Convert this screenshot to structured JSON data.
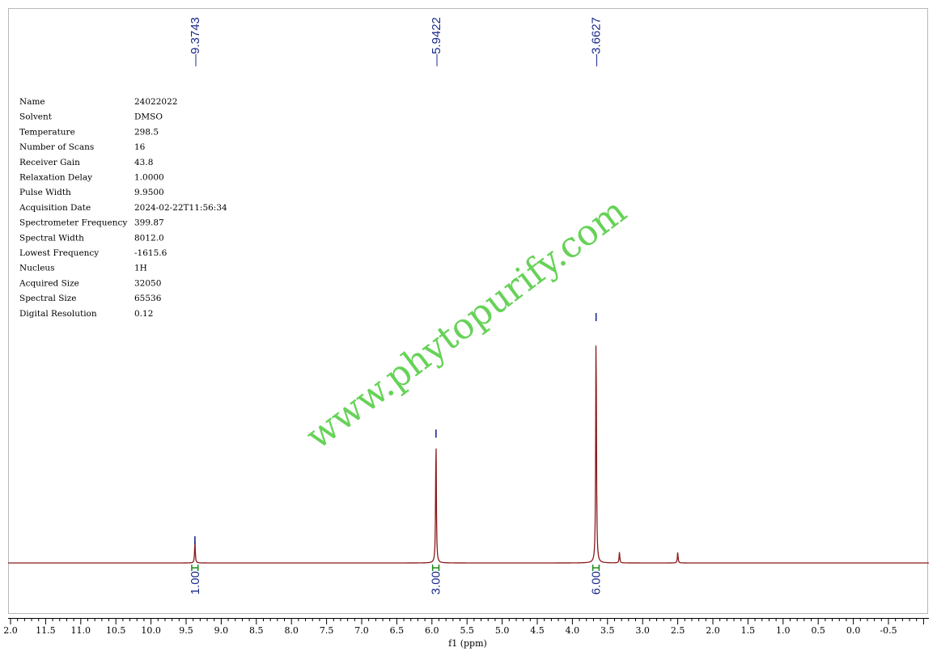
{
  "colors": {
    "spectrum": "#8b1a1a",
    "peak_marker": "#1a2a8c",
    "integration": "#1c8c1c",
    "watermark": "#5fd050",
    "frame": "#b8b8b8"
  },
  "watermark": "www.phytopurify.com",
  "parameters": [
    {
      "label": "Name",
      "value": "24022022"
    },
    {
      "label": "Solvent",
      "value": "DMSO"
    },
    {
      "label": "Temperature",
      "value": "298.5"
    },
    {
      "label": "Number of Scans",
      "value": "16"
    },
    {
      "label": "Receiver Gain",
      "value": "43.8"
    },
    {
      "label": "Relaxation Delay",
      "value": "1.0000"
    },
    {
      "label": "Pulse Width",
      "value": "9.9500"
    },
    {
      "label": "Acquisition Date",
      "value": "2024-02-22T11:56:34"
    },
    {
      "label": "Spectrometer Frequency",
      "value": "399.87"
    },
    {
      "label": "Spectral Width",
      "value": "8012.0"
    },
    {
      "label": "Lowest Frequency",
      "value": "-1615.6"
    },
    {
      "label": "Nucleus",
      "value": "1H"
    },
    {
      "label": "Acquired Size",
      "value": "32050"
    },
    {
      "label": "Spectral Size",
      "value": "65536"
    },
    {
      "label": "Digital Resolution",
      "value": "0.12"
    }
  ],
  "chart_data": {
    "type": "line",
    "xlabel": "f1 (ppm)",
    "xlim": [
      12.0,
      -1.0
    ],
    "x_reversed": true,
    "grid": false,
    "ticks": [
      {
        "value": 12.0,
        "label": "2.0"
      },
      {
        "value": 11.5,
        "label": "11.5"
      },
      {
        "value": 11.0,
        "label": "11.0"
      },
      {
        "value": 10.5,
        "label": "10.5"
      },
      {
        "value": 10.0,
        "label": "10.0"
      },
      {
        "value": 9.5,
        "label": "9.5"
      },
      {
        "value": 9.0,
        "label": "9.0"
      },
      {
        "value": 8.5,
        "label": "8.5"
      },
      {
        "value": 8.0,
        "label": "8.0"
      },
      {
        "value": 7.5,
        "label": "7.5"
      },
      {
        "value": 7.0,
        "label": "7.0"
      },
      {
        "value": 6.5,
        "label": "6.5"
      },
      {
        "value": 6.0,
        "label": "6.0"
      },
      {
        "value": 5.5,
        "label": "5.5"
      },
      {
        "value": 5.0,
        "label": "5.0"
      },
      {
        "value": 4.5,
        "label": "4.5"
      },
      {
        "value": 4.0,
        "label": "4.0"
      },
      {
        "value": 3.5,
        "label": "3.5"
      },
      {
        "value": 3.0,
        "label": "3.0"
      },
      {
        "value": 2.5,
        "label": "2.5"
      },
      {
        "value": 2.0,
        "label": "2.0"
      },
      {
        "value": 1.5,
        "label": "1.5"
      },
      {
        "value": 1.0,
        "label": "1.0"
      },
      {
        "value": 0.5,
        "label": "0.5"
      },
      {
        "value": 0.0,
        "label": "0.0"
      },
      {
        "value": -0.5,
        "label": "-0.5"
      }
    ],
    "peaks": [
      {
        "ppm": 9.3743,
        "label": "9.3743",
        "intensity": 0.09
      },
      {
        "ppm": 5.9422,
        "label": "5.9422",
        "intensity": 0.53
      },
      {
        "ppm": 3.6627,
        "label": "3.6627",
        "intensity": 1.0
      },
      {
        "ppm": 3.33,
        "intensity": 0.045
      },
      {
        "ppm": 2.5,
        "intensity": 0.045
      }
    ],
    "peak_markers": [
      {
        "ppm": 9.3743,
        "intensity": 0.11
      },
      {
        "ppm": 5.9422,
        "intensity": 0.55
      },
      {
        "ppm": 3.6627,
        "intensity": 1.03
      }
    ],
    "integrations": [
      {
        "from": 9.42,
        "to": 9.33,
        "label": "1.00"
      },
      {
        "from": 5.99,
        "to": 5.9,
        "label": "3.00"
      },
      {
        "from": 3.71,
        "to": 3.62,
        "label": "6.00"
      }
    ]
  }
}
